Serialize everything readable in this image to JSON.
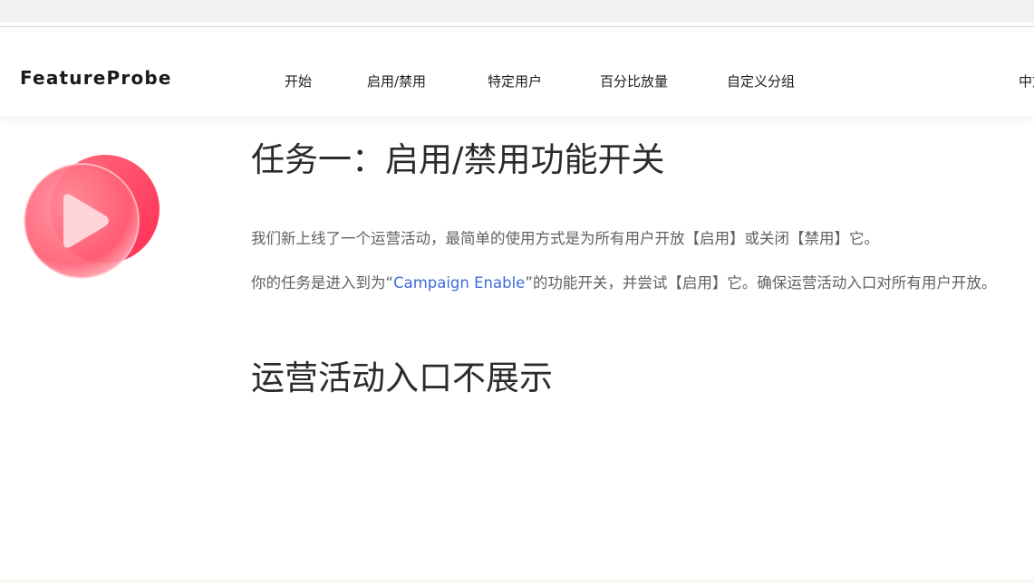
{
  "brand": {
    "logo_text": "FeatureProbe"
  },
  "nav": {
    "items": [
      {
        "label": "开始"
      },
      {
        "label": "启用/禁用"
      },
      {
        "label": "特定用户"
      },
      {
        "label": "百分比放量"
      },
      {
        "label": "自定义分组"
      }
    ],
    "language": "中文"
  },
  "hero": {
    "icon": "play-icon",
    "colors": {
      "primary": "#ff4f6a",
      "light": "#ffb0bb"
    }
  },
  "task": {
    "title": "任务一：启用/禁用功能开关",
    "paragraph_1": "我们新上线了一个运营活动，最简单的使用方式是为所有用户开放【启用】或关闭【禁用】它。",
    "paragraph_2_prefix": "你的任务是进入到为“",
    "paragraph_2_link": "Campaign Enable",
    "paragraph_2_suffix": "”的功能开关，并尝试【启用】它。确保运营活动入口对所有用户开放。"
  },
  "campaign": {
    "status_text": "运营活动入口不展示"
  },
  "colors": {
    "link": "#3f6bd8",
    "text": "#616161",
    "heading": "#2b2b2b"
  }
}
